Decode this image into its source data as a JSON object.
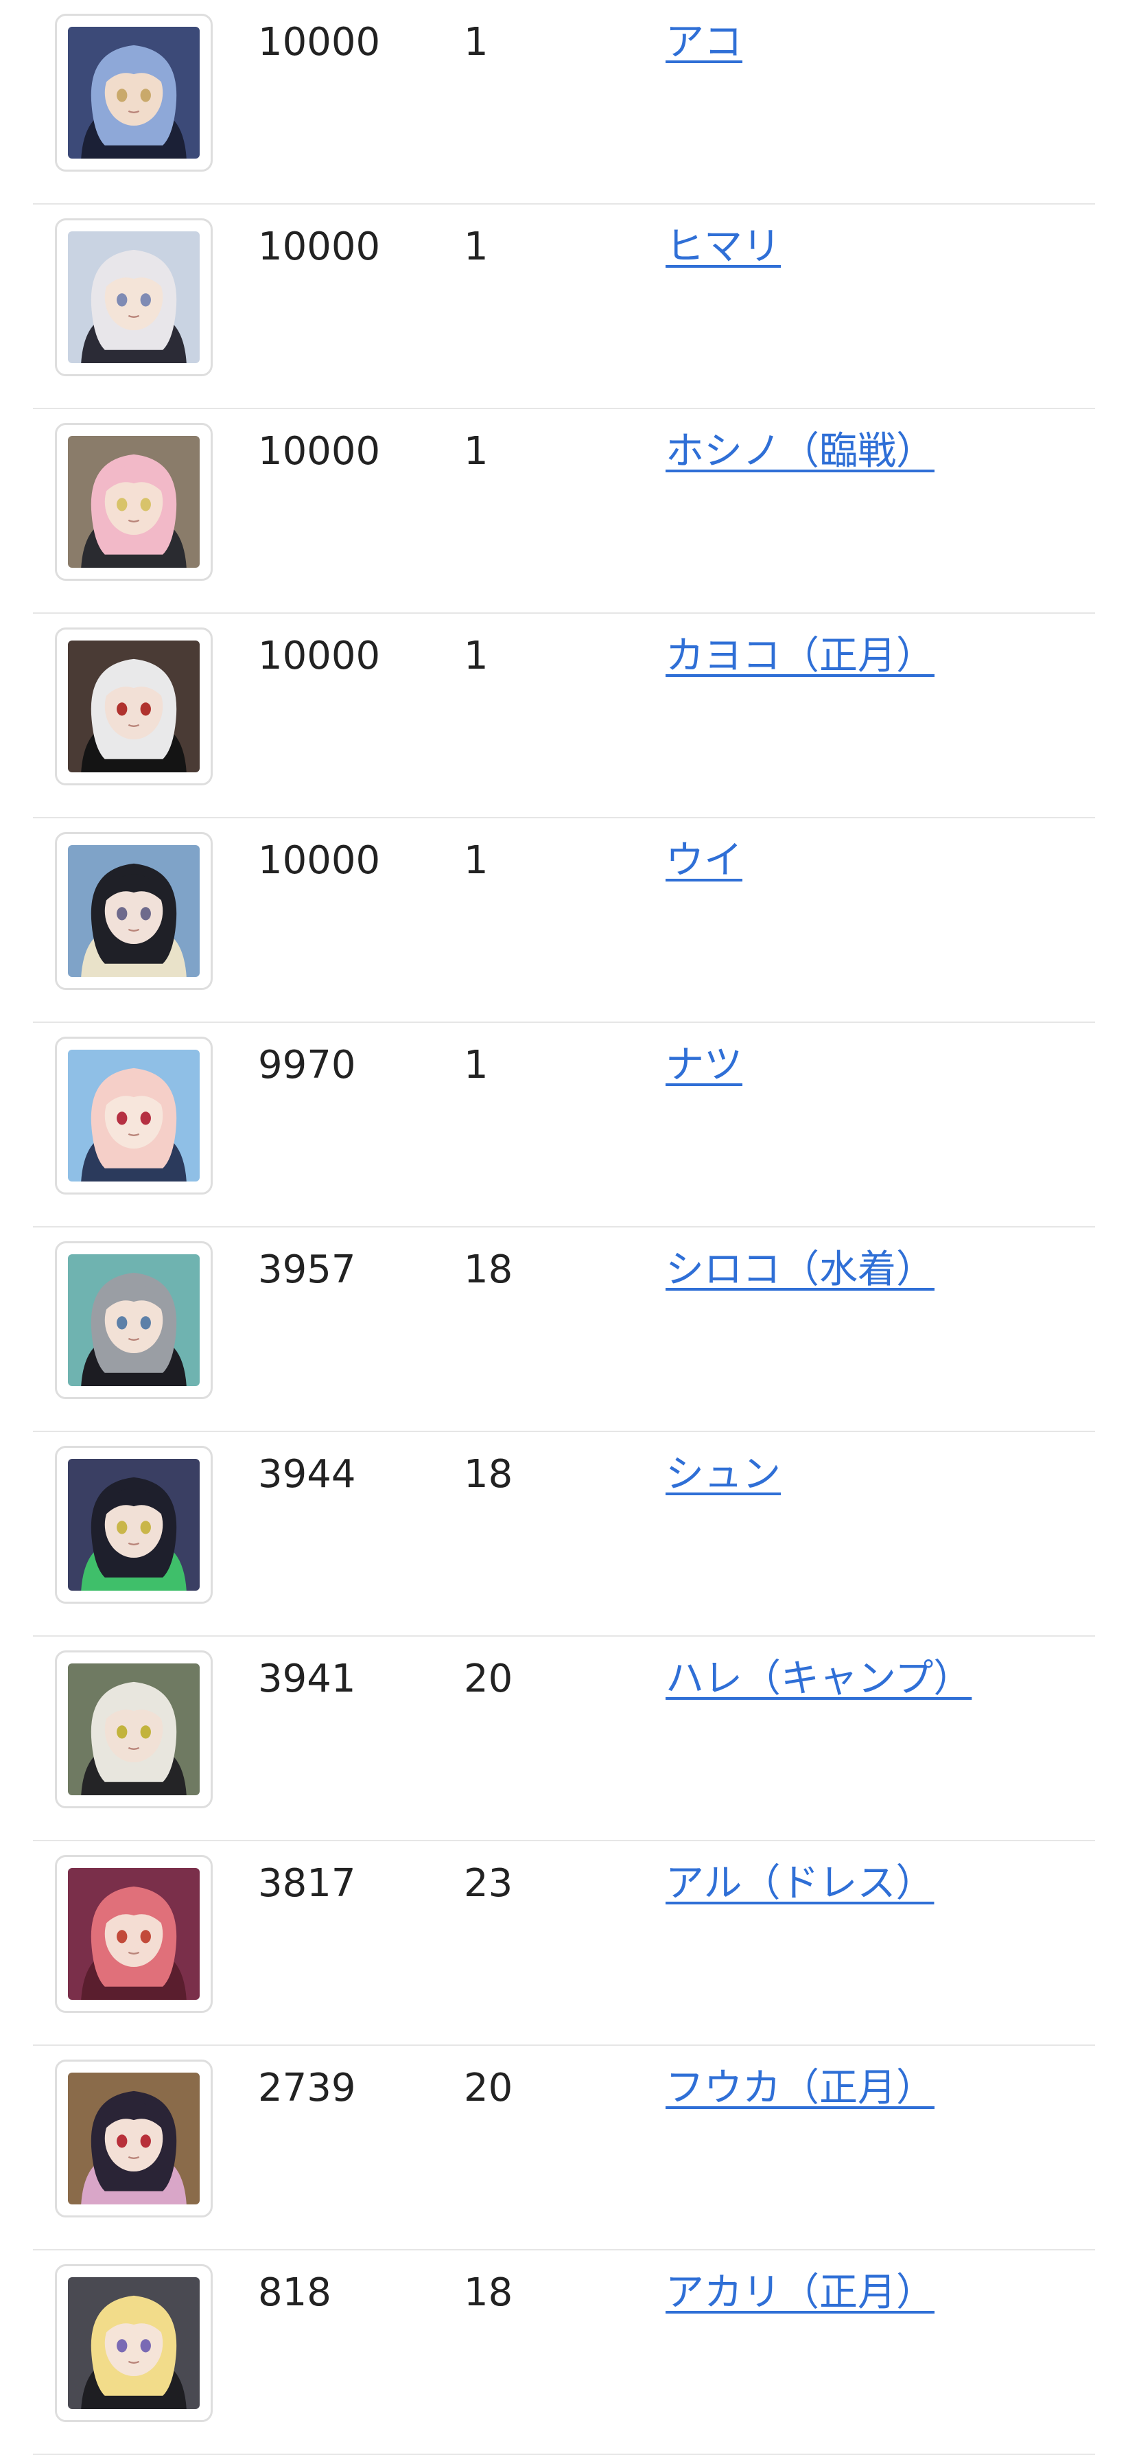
{
  "link_color": "#2f6fd6",
  "rows": [
    {
      "score": "10000",
      "rank": "1",
      "name": "アコ",
      "icon": "character-portrait-icon",
      "bg": "#3c4a78",
      "hair": "#8ea8d8",
      "skin": "#f1dccb",
      "eye": "#c9a96b",
      "accent": "#1b2036"
    },
    {
      "score": "10000",
      "rank": "1",
      "name": "ヒマリ",
      "icon": "character-portrait-icon",
      "bg": "#c9d3e2",
      "hair": "#e8e6ea",
      "skin": "#f4e4d8",
      "eye": "#7f8bb4",
      "accent": "#2b2b36"
    },
    {
      "score": "10000",
      "rank": "1",
      "name": "ホシノ（臨戦）",
      "icon": "character-portrait-icon",
      "bg": "#8a7c6a",
      "hair": "#f2b9c8",
      "skin": "#f5e0d4",
      "eye": "#d8c36a",
      "accent": "#2a2b30"
    },
    {
      "score": "10000",
      "rank": "1",
      "name": "カヨコ（正月）",
      "icon": "character-portrait-icon",
      "bg": "#4a3b35",
      "hair": "#e9e9ea",
      "skin": "#f2e0d6",
      "eye": "#b0322e",
      "accent": "#141414"
    },
    {
      "score": "10000",
      "rank": "1",
      "name": "ウイ",
      "icon": "character-portrait-icon",
      "bg": "#7fa3c8",
      "hair": "#1f2027",
      "skin": "#f1e1d9",
      "eye": "#6e6a8c",
      "accent": "#e9e2c9"
    },
    {
      "score": "9970",
      "rank": "1",
      "name": "ナツ",
      "icon": "character-portrait-icon",
      "bg": "#8fbfe6",
      "hair": "#f5cfc8",
      "skin": "#f7e6dc",
      "eye": "#b53042",
      "accent": "#2b3a5c"
    },
    {
      "score": "3957",
      "rank": "18",
      "name": "シロコ（水着）",
      "icon": "character-portrait-icon",
      "bg": "#6fb3b0",
      "hair": "#9a9ea4",
      "skin": "#f2e1d6",
      "eye": "#5d80a8",
      "accent": "#1c1c22"
    },
    {
      "score": "3944",
      "rank": "18",
      "name": "シュン",
      "icon": "character-portrait-icon",
      "bg": "#3a3f63",
      "hair": "#1e1f2c",
      "skin": "#f1e0d6",
      "eye": "#c9b64a",
      "accent": "#3fbf6a"
    },
    {
      "score": "3941",
      "rank": "20",
      "name": "ハレ（キャンプ）",
      "icon": "character-portrait-icon",
      "bg": "#6f7a62",
      "hair": "#e8e6de",
      "skin": "#f1e1d6",
      "eye": "#c2b33c",
      "accent": "#242426"
    },
    {
      "score": "3817",
      "rank": "23",
      "name": "アル（ドレス）",
      "icon": "character-portrait-icon",
      "bg": "#7a2f4a",
      "hair": "#e0707a",
      "skin": "#f4ddd3",
      "eye": "#c24a3a",
      "accent": "#5a1e2e"
    },
    {
      "score": "2739",
      "rank": "20",
      "name": "フウカ（正月）",
      "icon": "character-portrait-icon",
      "bg": "#8a6b4a",
      "hair": "#2a2436",
      "skin": "#f3e0d6",
      "eye": "#b8303a",
      "accent": "#d9a6c8"
    },
    {
      "score": "818",
      "rank": "18",
      "name": "アカリ（正月）",
      "icon": "character-portrait-icon",
      "bg": "#4a4a52",
      "hair": "#f2dc8a",
      "skin": "#f5e4d8",
      "eye": "#7a6ab4",
      "accent": "#1e1e22"
    }
  ]
}
